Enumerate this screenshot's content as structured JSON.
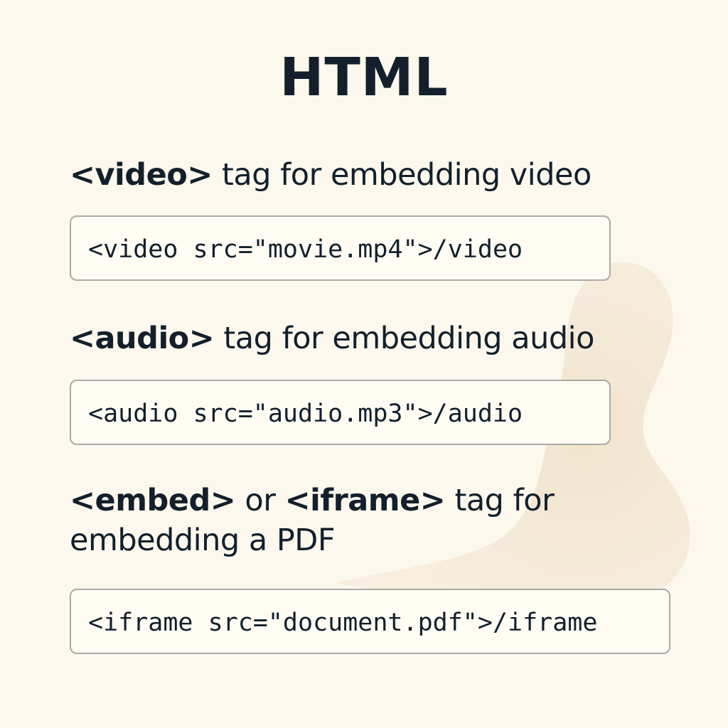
{
  "title": "HTML",
  "sections": [
    {
      "tag": "<video>",
      "description": " tag for embedding video",
      "code": "<video src=\"movie.mp4\">/video"
    },
    {
      "tag": "<audio>",
      "description": " tag for embedding audio",
      "code": "<audio src=\"audio.mp3\">/audio"
    },
    {
      "tag": "<embed>",
      "connector": " or ",
      "tag2": "<iframe>",
      "description": " tag for",
      "description_line2": "embedding a PDF",
      "code": "<iframe src=\"document.pdf\">/iframe"
    }
  ],
  "colors": {
    "background": "#fcf8ee",
    "text": "#13202b",
    "box_border": "#a9a9a5",
    "blob": "#f3e8d5"
  }
}
